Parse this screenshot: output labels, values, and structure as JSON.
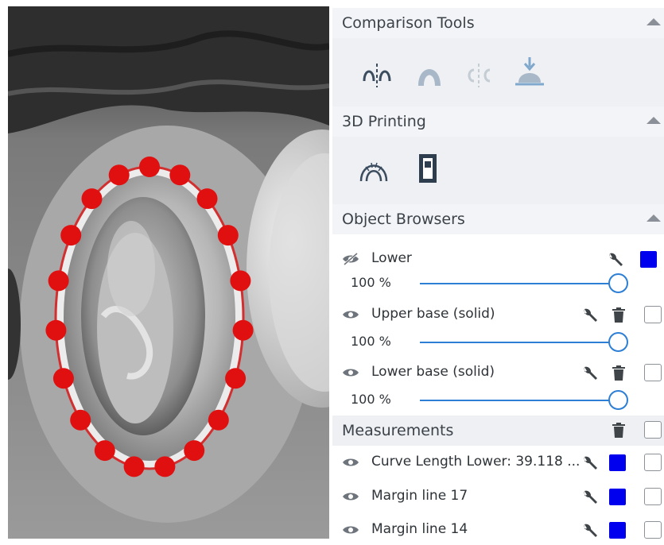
{
  "sections": {
    "comparison_tools": {
      "title": "Comparison Tools"
    },
    "printing_3d": {
      "title": "3D Printing"
    },
    "object_browsers": {
      "title": "Object Browsers"
    },
    "measurements": {
      "title": "Measurements"
    }
  },
  "objects": [
    {
      "label": "Lower",
      "opacity_label": "100 %",
      "opacity": 1.0,
      "visible": false,
      "color": "#0000ee"
    },
    {
      "label": "Upper base (solid)",
      "opacity_label": "100 %",
      "opacity": 1.0,
      "visible": true
    },
    {
      "label": "Lower base (solid)",
      "opacity_label": "100 %",
      "opacity": 1.0,
      "visible": true
    }
  ],
  "measurements": [
    {
      "label": "Curve Length Lower: 39.118 ...",
      "color": "#0000ee",
      "checked": false
    },
    {
      "label": "Margin line 17",
      "color": "#0000ee",
      "checked": false
    },
    {
      "label": "Margin line 14",
      "color": "#0000ee",
      "checked": false
    }
  ],
  "icons": {
    "comparison": [
      "split-compare-icon",
      "arch-overlay-icon",
      "mirror-compare-icon",
      "occlusion-import-icon"
    ],
    "printing": [
      "arch-model-icon",
      "die-model-icon"
    ]
  },
  "colors": {
    "accent": "#2d7fd6",
    "swatch": "#0000ee",
    "margin_points": "#e01010"
  }
}
